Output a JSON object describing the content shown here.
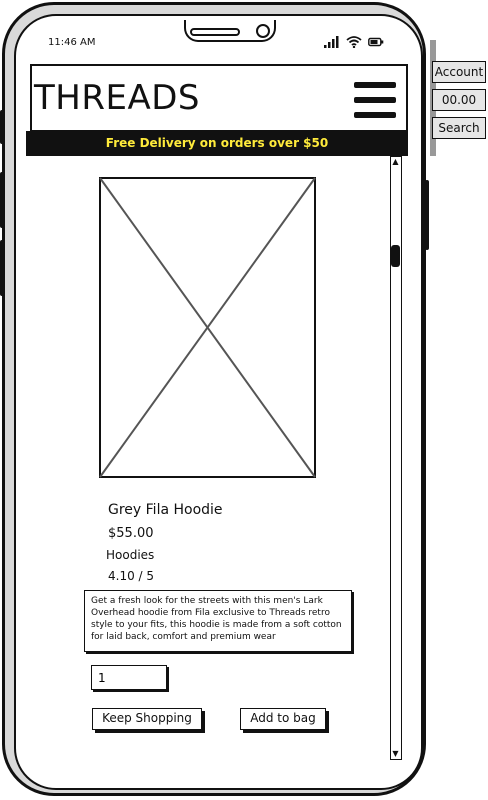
{
  "status_bar": {
    "time": "11:46 AM"
  },
  "header": {
    "logo": "THREADS"
  },
  "promo": {
    "text": "Free Delivery on orders over $50"
  },
  "side_panel": {
    "account_label": "Account",
    "price_label": "00.00",
    "search_label": "Search"
  },
  "product": {
    "name": "Grey Fila Hoodie",
    "price": "$55.00",
    "category": "Hoodies",
    "rating": "4.10 / 5",
    "description": "Get a fresh look for the streets with this men's Lark Overhead hoodie from Fila exclusive to Threads retro style to your fits, this hoodie is made from a soft cotton for laid back, comfort and premium wear"
  },
  "quantity": {
    "value": "1"
  },
  "actions": {
    "keep_shopping_label": "Keep Shopping",
    "add_to_bag_label": "Add to bag"
  },
  "icons": [
    "signal-icon",
    "wifi-icon",
    "battery-icon",
    "hamburger-menu-icon",
    "image-placeholder-icon",
    "scroll-up-icon",
    "scroll-down-icon"
  ]
}
